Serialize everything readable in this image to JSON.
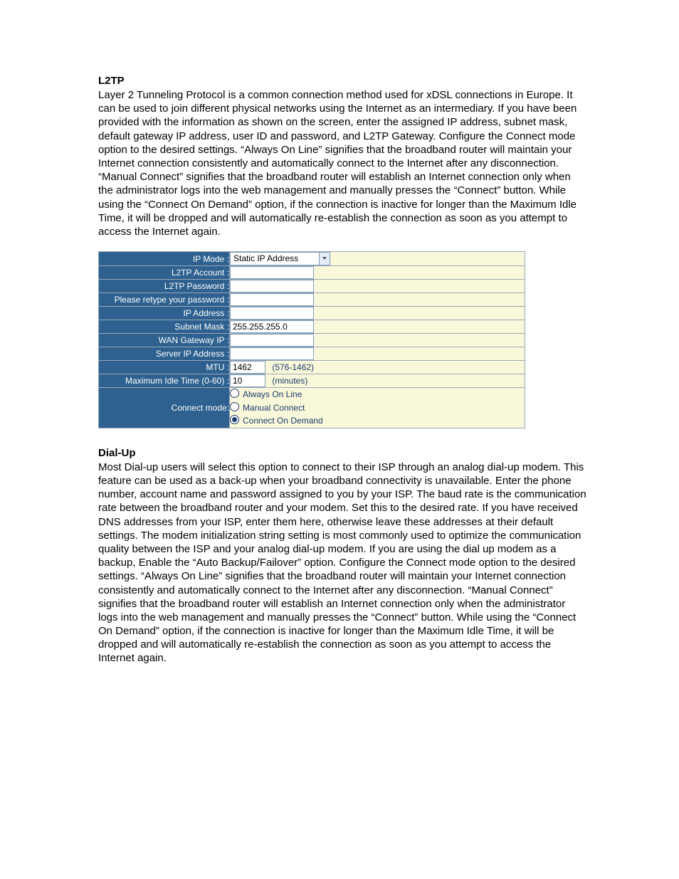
{
  "sections": {
    "l2tp": {
      "heading": "L2TP",
      "body": "Layer 2 Tunneling Protocol is a common connection method used for xDSL connections in Europe. It can be used to join different physical networks using the Internet as an intermediary. If you have been provided with the information as shown on the screen, enter the assigned IP address, subnet mask, default gateway IP address, user ID and password, and L2TP Gateway. Configure the Connect mode option to the desired settings. “Always On Line” signifies that the broadband router will maintain your Internet connection consistently and automatically connect to the Internet after any disconnection. “Manual Connect” signifies that the broadband router will establish an Internet connection only when the administrator logs into the web management and manually presses the “Connect” button. While using the “Connect On Demand” option, if the connection is inactive for longer than the Maximum Idle Time, it will be dropped and will automatically re-establish the connection as soon as you attempt to access the Internet again."
    },
    "dialup": {
      "heading": "Dial-Up",
      "body": "Most Dial-up users will select this option to connect to their ISP through an analog dial-up modem. This feature can be used as a back-up when your broadband connectivity is unavailable. Enter the phone number, account name and password assigned to you by your ISP. The baud rate is the communication rate between the broadband router and your modem. Set this to the desired rate. If you have received DNS addresses from your ISP, enter them here, otherwise leave these addresses at their default settings. The modem initialization string setting is most commonly used to optimize the communication quality between the ISP and your analog dial-up modem. If you are using the dial up modem as a backup, Enable the “Auto Backup/Failover” option. Configure the Connect mode option to the desired settings. “Always On Line” signifies that the broadband router will maintain your Internet connection consistently and automatically connect to the Internet after any disconnection. “Manual Connect” signifies that the broadband router will establish an Internet connection only when the administrator logs into the web management and manually presses the “Connect” button. While using the “Connect On Demand” option, if the connection is inactive for longer than the Maximum Idle Time, it will be dropped and will automatically re-establish the connection as soon as you attempt to access the Internet again."
    }
  },
  "form": {
    "ip_mode": {
      "label": "IP Mode :",
      "value": "Static IP Address"
    },
    "l2tp_account": {
      "label": "L2TP Account :",
      "value": ""
    },
    "l2tp_password": {
      "label": "L2TP Password :",
      "value": ""
    },
    "retype_password": {
      "label": "Please retype your password :",
      "value": ""
    },
    "ip_address": {
      "label": "IP Address :",
      "value": ""
    },
    "subnet_mask": {
      "label": "Subnet Mask :",
      "value": "255.255.255.0"
    },
    "wan_gateway_ip": {
      "label": "WAN Gateway IP :",
      "value": ""
    },
    "server_ip_address": {
      "label": "Server IP Address :",
      "value": ""
    },
    "mtu": {
      "label": "MTU :",
      "value": "1462",
      "hint": "(576-1462)"
    },
    "max_idle": {
      "label": "Maximum Idle Time (0-60) :",
      "value": "10",
      "hint": "(minutes)"
    },
    "connect_mode": {
      "label": "Connect mode:",
      "options": {
        "always": "Always On Line",
        "manual": "Manual Connect",
        "demand": "Connect On Demand"
      },
      "selected": "demand"
    }
  }
}
